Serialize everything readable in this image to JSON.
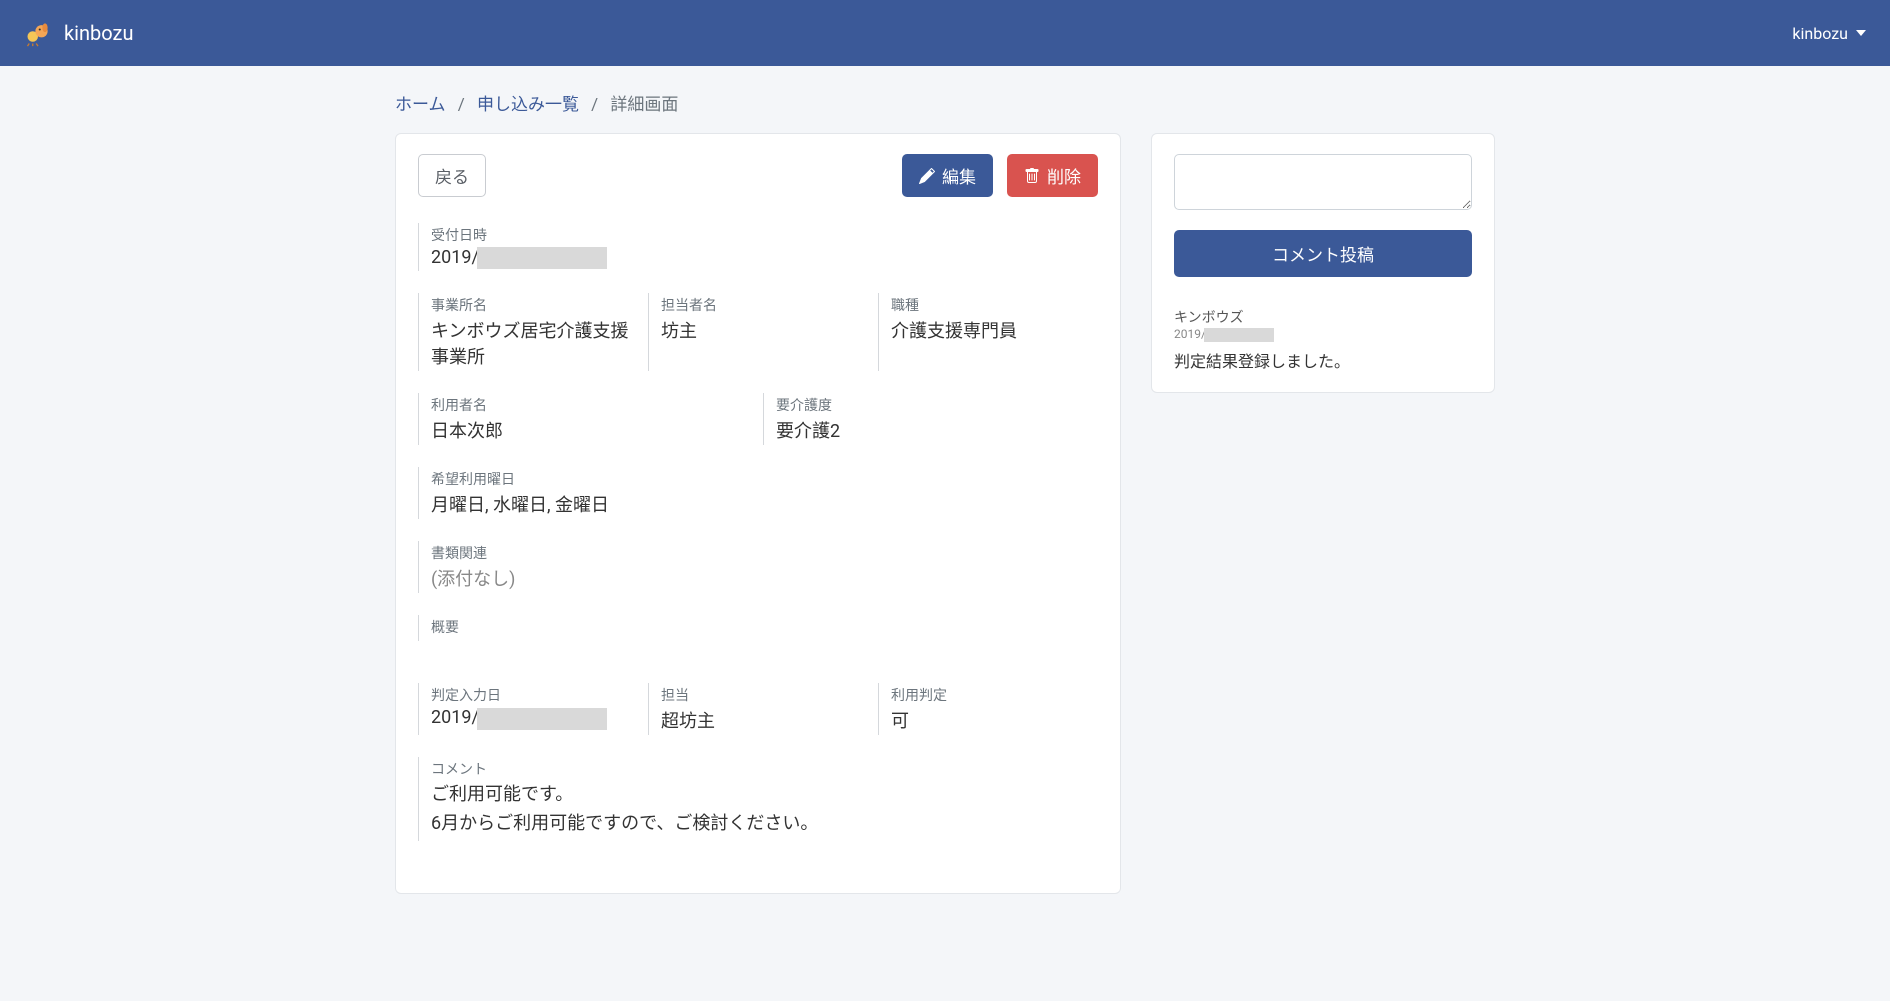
{
  "navbar": {
    "brand": "kinbozu",
    "user": "kinbozu"
  },
  "breadcrumb": {
    "home": "ホーム",
    "list": "申し込み一覧",
    "current": "詳細画面"
  },
  "actions": {
    "back": "戻る",
    "edit": "編集",
    "delete": "削除"
  },
  "detail": {
    "received_at_label": "受付日時",
    "received_at_prefix": "2019/",
    "office_label": "事業所名",
    "office_value": "キンボウズ居宅介護支援事業所",
    "contact_label": "担当者名",
    "contact_value": "坊主",
    "role_label": "職種",
    "role_value": "介護支援専門員",
    "user_label": "利用者名",
    "user_value": "日本次郎",
    "care_level_label": "要介護度",
    "care_level_value": "要介護2",
    "days_label": "希望利用曜日",
    "days_value": "月曜日, 水曜日, 金曜日",
    "docs_label": "書類関連",
    "docs_value": "(添付なし)",
    "summary_label": "概要",
    "decision_date_label": "判定入力日",
    "decision_date_prefix": "2019/",
    "decision_contact_label": "担当",
    "decision_contact_value": "超坊主",
    "decision_label": "利用判定",
    "decision_value": "可",
    "comment_label": "コメント",
    "comment_line1": "ご利用可能です。",
    "comment_line2": "6月からご利用可能ですので、ご検討ください。"
  },
  "sidebar": {
    "post_button": "コメント投稿",
    "comments": [
      {
        "author": "キンボウズ",
        "date_prefix": "2019/",
        "body": "判定結果登録しました。"
      }
    ]
  }
}
